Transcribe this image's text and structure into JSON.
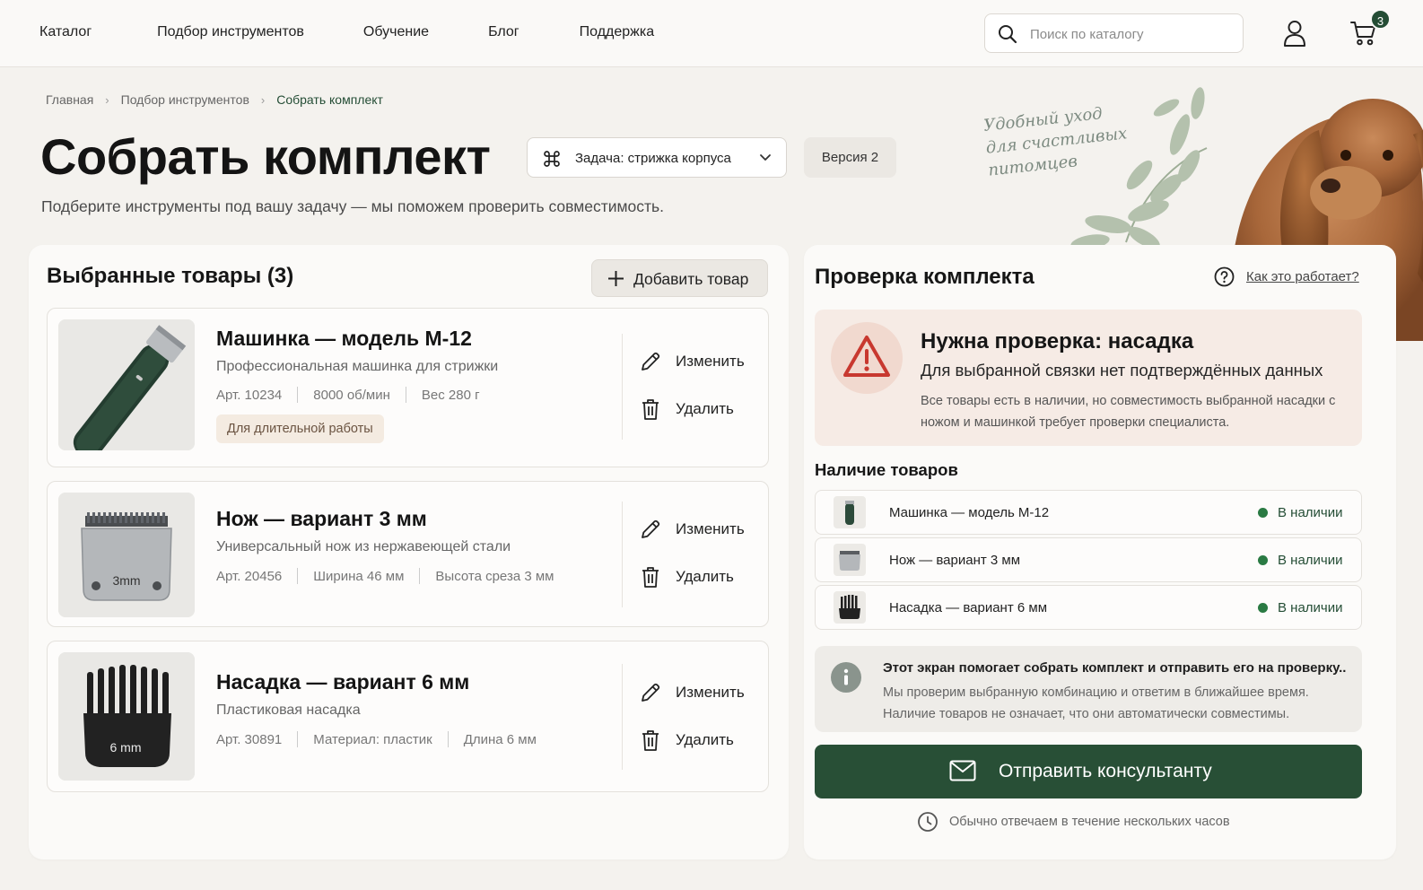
{
  "nav": {
    "items": [
      "Каталог",
      "Подбор инструментов",
      "Обучение",
      "Блог",
      "Поддержка"
    ],
    "search_placeholder": "Поиск по каталогу",
    "cart_count": "3"
  },
  "breadcrumb": [
    "Главная",
    "Подбор инструментов",
    "Собрать комплект"
  ],
  "hero": {
    "title": "Собрать комплект",
    "subtitle": "Подберите инструменты под вашу задачу — мы поможем проверить совместимость.",
    "task_label": "Задача: стрижка корпуса",
    "version_label": "Версия 2",
    "slogan": [
      "Удобный уход",
      "для счастливых",
      "питомцев"
    ]
  },
  "selected": {
    "title": "Выбранные товары (3)",
    "add_label": "Добавить товар",
    "edit_label": "Изменить",
    "delete_label": "Удалить",
    "products": [
      {
        "title": "Машинка — модель М-12",
        "desc": "Профессиональная машинка для стрижки",
        "specs": [
          "Арт. 10234",
          "8000 об/мин",
          "Вес 280 г"
        ],
        "tag": "Для длительной работы"
      },
      {
        "title": "Нож — вариант 3 мм",
        "desc": "Универсальный нож из нержавеющей стали",
        "specs": [
          "Арт. 20456",
          "Ширина 46 мм",
          "Высота среза 3 мм"
        ],
        "img_label": "3mm"
      },
      {
        "title": "Насадка — вариант 6 мм",
        "desc": "Пластиковая насадка",
        "specs": [
          "Арт. 30891",
          "Материал: пластик",
          "Длина 6 мм"
        ],
        "img_label": "6 mm"
      }
    ]
  },
  "check": {
    "title": "Проверка комплекта",
    "help_label": "Как это работает?",
    "alert": {
      "title": "Нужна проверка: насадка",
      "subtitle": "Для выбранной связки нет подтверждённых данных",
      "body": "Все товары есть в наличии, но совместимость выбранной насадки с ножом и машинкой требует проверки специалиста."
    },
    "availability_title": "Наличие товаров",
    "availability": [
      {
        "name": "Машинка — модель М-12",
        "status": "В наличии"
      },
      {
        "name": "Нож — вариант 3 мм",
        "status": "В наличии"
      },
      {
        "name": "Насадка — вариант 6 мм",
        "status": "В наличии"
      }
    ],
    "info": {
      "title": "Этот экран помогает собрать комплект и отправить его на проверку..",
      "line1": "Мы проверим выбранную комбинацию и ответим в ближайшее время.",
      "line2": "Наличие товаров не означает, что они автоматически совместимы."
    },
    "send_label": "Отправить консультанту",
    "reply_note": "Обычно отвечаем в течение нескольких часов"
  },
  "colors": {
    "accent": "#284f36",
    "alert_bg": "#f6ebe5",
    "alert_icon": "#c8382f",
    "in_stock": "#2a7a43"
  }
}
